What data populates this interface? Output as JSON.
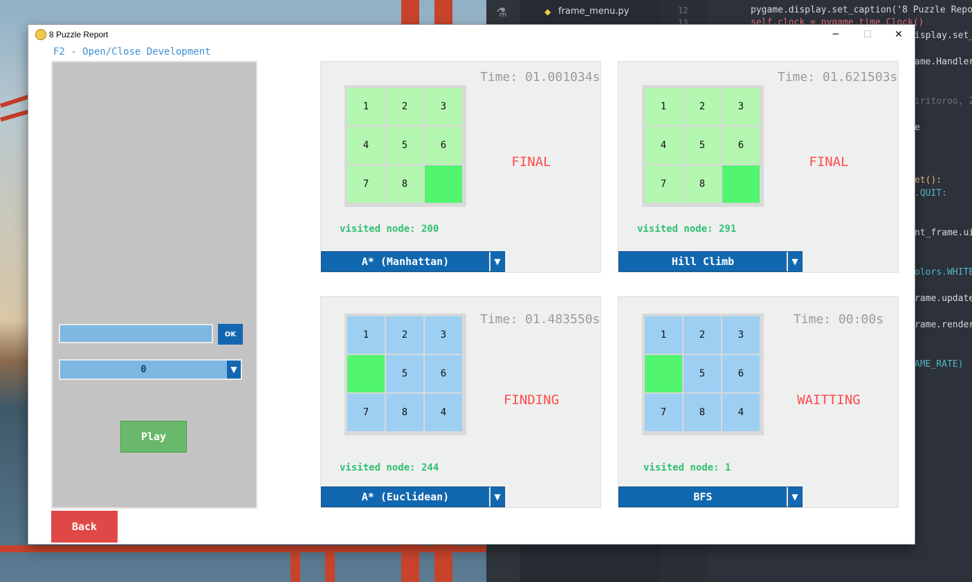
{
  "window": {
    "title": "8 Puzzle Report",
    "minimize_icon": "minimize-icon",
    "maximize_icon": "maximize-icon",
    "close_icon": "close-icon"
  },
  "dev_hint": "F2 - Open/Close Development",
  "controls": {
    "input_value": "",
    "ok_label": "OK",
    "count_selected": "0",
    "play_label": "Play",
    "back_label": "Back"
  },
  "panels": [
    {
      "time": "Time: 01.001034s",
      "status": "FINAL",
      "visited": "visited node: 200",
      "algorithm": "A* (Manhattan)",
      "tiles": [
        "1",
        "2",
        "3",
        "4",
        "5",
        "6",
        "7",
        "8",
        ""
      ],
      "tile_color": "#b3f7b0",
      "blank_color": "#52f56f"
    },
    {
      "time": "Time: 01.621503s",
      "status": "FINAL",
      "visited": "visited node: 291",
      "algorithm": "Hill Climb",
      "tiles": [
        "1",
        "2",
        "3",
        "4",
        "5",
        "6",
        "7",
        "8",
        ""
      ],
      "tile_color": "#b3f7b0",
      "blank_color": "#52f56f"
    },
    {
      "time": "Time: 01.483550s",
      "status": "FINDING",
      "visited": "visited node: 244",
      "algorithm": "A* (Euclidean)",
      "tiles": [
        "1",
        "2",
        "3",
        "",
        "5",
        "6",
        "7",
        "8",
        "4"
      ],
      "tile_color": "#9dcff3",
      "blank_color": "#52f56f"
    },
    {
      "time": "Time: 00:00s",
      "status": "WAITTING",
      "visited": "visited node: 1",
      "algorithm": "BFS",
      "tiles": [
        "1",
        "2",
        "3",
        "",
        "5",
        "6",
        "7",
        "8",
        "4"
      ],
      "tile_color": "#9dcff3",
      "blank_color": "#52f56f"
    }
  ],
  "editor": {
    "file_name": "frame_menu.py",
    "gutter": [
      "12",
      "13"
    ],
    "lines": [
      "pygame.display.set_caption('8 Puzzle Repor",
      "self.clock = pygame.time.Clock()",
      "isplay.set_",
      "ame.Handler",
      "iritoroo, 2",
      "e",
      "et():",
      ".QUIT:",
      "nt_frame.ui",
      "olors.WHITE",
      "rame.update",
      "rame.render",
      "AME_RATE)"
    ]
  },
  "colors": {
    "accent": "#1268b0",
    "status_red": "#ff4a4a",
    "visited_green": "#2fbf71",
    "play_green": "#6ab86a",
    "back_red": "#e04848"
  }
}
